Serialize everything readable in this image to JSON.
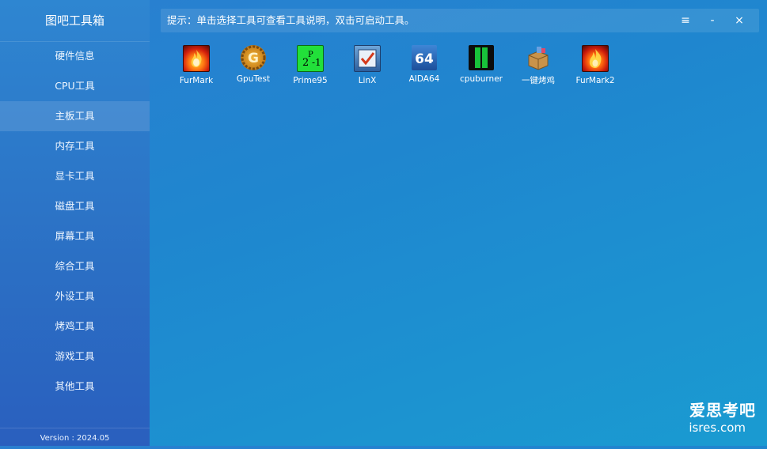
{
  "app": {
    "title": "图吧工具箱",
    "version": "Version : 2024.05"
  },
  "sidebar": {
    "items": [
      {
        "label": "硬件信息"
      },
      {
        "label": "CPU工具"
      },
      {
        "label": "主板工具",
        "active": true
      },
      {
        "label": "内存工具"
      },
      {
        "label": "显卡工具"
      },
      {
        "label": "磁盘工具"
      },
      {
        "label": "屏幕工具"
      },
      {
        "label": "综合工具"
      },
      {
        "label": "外设工具"
      },
      {
        "label": "烤鸡工具"
      },
      {
        "label": "游戏工具"
      },
      {
        "label": "其他工具"
      }
    ]
  },
  "topbar": {
    "hint": "提示：单击选择工具可查看工具说明，双击可启动工具。",
    "menu_glyph": "≡",
    "minimize_glyph": "-",
    "close_glyph": "×"
  },
  "tools": [
    {
      "label": "FurMark",
      "icon": "furmark-icon"
    },
    {
      "label": "GpuTest",
      "icon": "gputest-icon"
    },
    {
      "label": "Prime95",
      "icon": "prime95-icon"
    },
    {
      "label": "LinX",
      "icon": "linx-icon"
    },
    {
      "label": "AIDA64",
      "icon": "aida64-icon"
    },
    {
      "label": "cpuburner",
      "icon": "cpuburner-icon"
    },
    {
      "label": "一键烤鸡",
      "icon": "package-icon"
    },
    {
      "label": "FurMark2",
      "icon": "furmark2-icon"
    }
  ],
  "watermark": {
    "line1": "爱思考吧",
    "line2": "isres.com"
  }
}
